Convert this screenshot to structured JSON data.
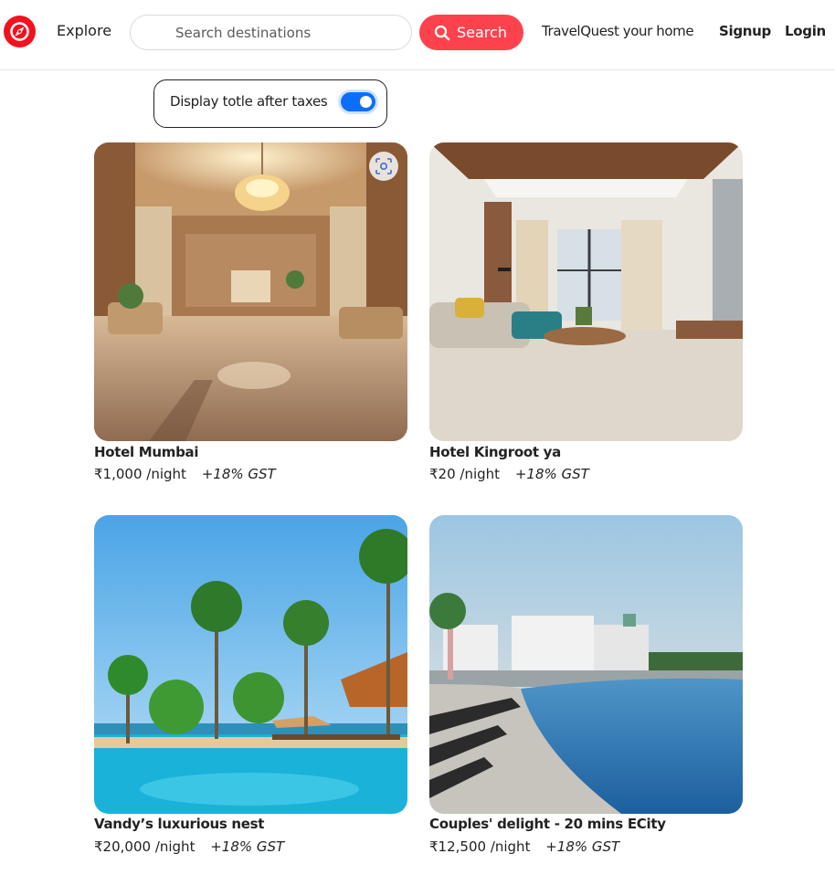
{
  "nav": {
    "explore": "Explore",
    "search_placeholder": "Search destinations",
    "search_button": "Search",
    "home_link": "TravelQuest your home",
    "signup": "Signup",
    "login": "Login"
  },
  "tax_toggle": {
    "label": "Display totle after taxes",
    "enabled": true
  },
  "listings": [
    {
      "title": "Hotel Mumbai",
      "price": "₹1,000",
      "per": "/night",
      "tax": "+18% GST",
      "image": "hotel-lobby-photo"
    },
    {
      "title": "Hotel Kingroot ya",
      "price": "₹20",
      "per": "/night",
      "tax": "+18% GST",
      "image": "living-room-photo"
    },
    {
      "title": "Vandy’s luxurious nest",
      "price": "₹20,000",
      "per": "/night",
      "tax": "+18% GST",
      "image": "tropical-pool-photo"
    },
    {
      "title": "Couples' delight - 20 mins ECity",
      "price": "₹12,500",
      "per": "/night",
      "tax": "+18% GST",
      "image": "resort-pool-photo"
    }
  ],
  "colors": {
    "brand": "#fe424d",
    "logo": "#f4101e",
    "toggle": "#0d6efd",
    "text": "#222222"
  },
  "icons": {
    "logo": "compass-icon",
    "search": "search-icon",
    "image_lens": "lens-icon"
  }
}
